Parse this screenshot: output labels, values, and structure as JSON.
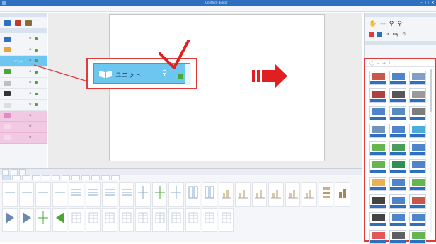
{
  "window": {
    "title": "Untitled - Editor",
    "controls": [
      "–",
      "□",
      "×"
    ]
  },
  "menubar": [
    "",
    "",
    "",
    "",
    "",
    "",
    ""
  ],
  "left_panel": {
    "header": "",
    "subheader": "",
    "items": [
      {
        "label": "",
        "color": "#2f6fc0",
        "pink": false,
        "selected": false
      },
      {
        "label": "",
        "color": "#e9a33a",
        "pink": false,
        "selected": false
      },
      {
        "label": "ユニット",
        "color": "#6cc6ef",
        "pink": false,
        "selected": true
      },
      {
        "label": "",
        "color": "#4aa832",
        "pink": false,
        "selected": false
      },
      {
        "label": "",
        "color": "#bfbfbf",
        "pink": false,
        "selected": false
      },
      {
        "label": "",
        "color": "#333333",
        "pink": false,
        "selected": false
      },
      {
        "label": "",
        "color": "#dddddd",
        "pink": false,
        "selected": false
      },
      {
        "label": "",
        "color": "#e48ac2",
        "pink": true,
        "selected": false
      },
      {
        "label": "",
        "color": "#f6d8ec",
        "pink": true,
        "selected": false
      },
      {
        "label": "",
        "color": "#f6d8ec",
        "pink": true,
        "selected": false
      }
    ]
  },
  "callout": {
    "label": "ユニット",
    "pin": "⚲"
  },
  "canvas": {
    "status": ""
  },
  "bottom_panel": {
    "tabs": [
      "",
      "",
      ""
    ],
    "filters": [
      "",
      "",
      "",
      "",
      "",
      "",
      "",
      "",
      "",
      "",
      "",
      ""
    ],
    "tiles": [
      "",
      "",
      "",
      "",
      "",
      "",
      "",
      "",
      "",
      "",
      "",
      "",
      "",
      "",
      "",
      "",
      "",
      "",
      "",
      "",
      "",
      "",
      "",
      "",
      "",
      "",
      "",
      "",
      "",
      "",
      "",
      "",
      "",
      "",
      ""
    ]
  },
  "right_panel": {
    "header": "",
    "subheader": "",
    "tool_symbols": [
      "✋",
      "⇦",
      "⚲",
      "⚲",
      "α",
      "ɑγ",
      "⊙"
    ]
  },
  "catalog": {
    "nav": [
      "◯",
      "←",
      "→",
      "↑"
    ],
    "caption": "",
    "items": [
      {
        "label": "",
        "color": "#c0392b"
      },
      {
        "label": "",
        "color": "#2f6fc0"
      },
      {
        "label": "",
        "color": "#6c8ebf"
      },
      {
        "label": "",
        "color": "#a02020"
      },
      {
        "label": "",
        "color": "#3a3a3a"
      },
      {
        "label": "",
        "color": "#888888"
      },
      {
        "label": "",
        "color": "#2f6fc0"
      },
      {
        "label": "",
        "color": "#3a76b5"
      },
      {
        "label": "",
        "color": "#666666"
      },
      {
        "label": "",
        "color": "#5a7fb0"
      },
      {
        "label": "",
        "color": "#2f6fc0"
      },
      {
        "label": "",
        "color": "#2aa0d6"
      },
      {
        "label": "",
        "color": "#4aa832"
      },
      {
        "label": "",
        "color": "#2b8a3e"
      },
      {
        "label": "",
        "color": "#2f6fc0"
      },
      {
        "label": "",
        "color": "#4aa832"
      },
      {
        "label": "",
        "color": "#0d7a38"
      },
      {
        "label": "",
        "color": "#2f6fc0"
      },
      {
        "label": "",
        "color": "#e8a33a"
      },
      {
        "label": "",
        "color": "#2f6fc0"
      },
      {
        "label": "",
        "color": "#4aa832"
      },
      {
        "label": "",
        "color": "#222222"
      },
      {
        "label": "",
        "color": "#2f6fc0"
      },
      {
        "label": "",
        "color": "#c0392b"
      },
      {
        "label": "",
        "color": "#222222"
      },
      {
        "label": "",
        "color": "#2f6fc0"
      },
      {
        "label": "",
        "color": "#2f6fc0"
      },
      {
        "label": "",
        "color": "#e03a3a"
      },
      {
        "label": "",
        "color": "#444444"
      },
      {
        "label": "",
        "color": "#4aa832"
      }
    ]
  },
  "arrow": {
    "color": "#e02020"
  }
}
